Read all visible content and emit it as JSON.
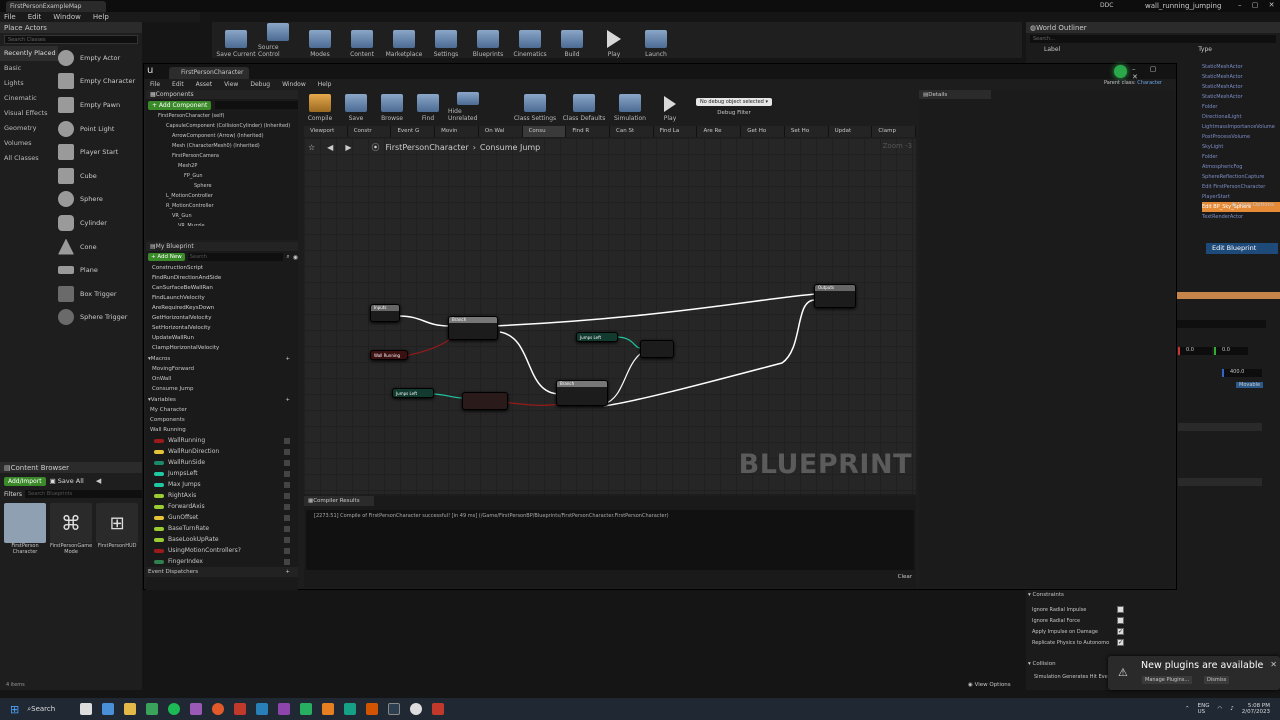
{
  "editor": {
    "title_tab": "FirstPersonExampleMap",
    "project_name": "wall_running_jumping",
    "menu": [
      "File",
      "Edit",
      "Window",
      "Help"
    ],
    "source_label": "DDC"
  },
  "place_actors": {
    "tab": "Place Actors",
    "search_placeholder": "Search Classes",
    "categories": [
      "Recently Placed",
      "Basic",
      "Lights",
      "Cinematic",
      "Visual Effects",
      "Geometry",
      "Volumes",
      "All Classes"
    ],
    "items": [
      "Empty Actor",
      "Empty Character",
      "Empty Pawn",
      "Point Light",
      "Player Start",
      "Cube",
      "Sphere",
      "Cylinder",
      "Cone",
      "Plane",
      "Box Trigger",
      "Sphere Trigger"
    ]
  },
  "main_toolbar": [
    "Save Current",
    "Source Control",
    "Modes",
    "Content",
    "Marketplace",
    "Settings",
    "Blueprints",
    "Cinematics",
    "Build",
    "Play",
    "Launch"
  ],
  "world_outliner": {
    "tab": "World Outliner",
    "search_placeholder": "Search...",
    "col_label": "Label",
    "col_type": "Type",
    "types": [
      "StaticMeshActor",
      "StaticMeshActor",
      "StaticMeshActor",
      "StaticMeshActor",
      "Folder",
      "DirectionalLight",
      "LightmassImportanceVolume",
      "PostProcessVolume",
      "SkyLight",
      "Folder",
      "AtmosphericFog",
      "SphereReflectionCapture",
      "Edit FirstPersonCharacter",
      "PlayerStart",
      "Edit BP_Sky_Sphere",
      "TextRenderActor"
    ],
    "view_options": "View Options",
    "edit_blueprint": "Edit Blueprint"
  },
  "blueprint_editor": {
    "tab": "FirstPersonCharacter",
    "parent_class_label": "Parent class:",
    "parent_class": "Character",
    "menu": [
      "File",
      "Edit",
      "Asset",
      "View",
      "Debug",
      "Window",
      "Help"
    ],
    "toolbar": [
      "Compile",
      "Save",
      "Browse",
      "Find",
      "Hide Unrelated",
      "Class Settings",
      "Class Defaults",
      "Simulation",
      "Play"
    ],
    "debug_filter_value": "No debug object selected",
    "debug_filter_label": "Debug Filter",
    "graph_tabs": [
      "Viewport",
      "Constr",
      "Event G",
      "Movin",
      "On Wal",
      "Consu",
      "Find R",
      "Can St",
      "Find La",
      "Are Re",
      "Get Ho",
      "Set Ho",
      "Updat",
      "Clamp"
    ],
    "breadcrumb_root": "FirstPersonCharacter",
    "breadcrumb_leaf": "Consume Jump",
    "zoom": "Zoom -3",
    "watermark": "BLUEPRINT",
    "components": {
      "tab": "Components",
      "add_button": "+ Add Component",
      "tree": [
        "FirstPersonCharacter (self)",
        "CapsuleComponent (CollisionCylinder) (Inherited)",
        "ArrowComponent (Arrow) (Inherited)",
        "Mesh (CharacterMesh0) (Inherited)",
        "FirstPersonCamera",
        "Mesh2P",
        "FP_Gun",
        "Sphere",
        "L_MotionController",
        "R_MotionController",
        "VR_Gun",
        "VR_Muzzle"
      ]
    },
    "my_blueprint": {
      "tab": "My Blueprint",
      "add_new": "+ Add New",
      "search_placeholder": "Search",
      "functions": [
        "ConstructionScript",
        "FindRunDirectionAndSide",
        "CanSurfaceBeWallRan",
        "FindLaunchVelocity",
        "AreRequiredKeysDown",
        "GetHorizontalVelocity",
        "SetHorizontalVelocity",
        "UpdateWallRun",
        "ClampHorizontalVelocity"
      ],
      "macros_label": "Macros",
      "macros": [
        "MovingForward",
        "OnWall",
        "Consume Jump"
      ],
      "variables_label": "Variables",
      "var_groups": [
        "My Character",
        "Components"
      ],
      "wall_running_label": "Wall Running",
      "variables": [
        {
          "name": "WallRunning",
          "color": "#9b1a1a"
        },
        {
          "name": "WallRunDirection",
          "color": "#e6c43a"
        },
        {
          "name": "WallRunSide",
          "color": "#1a8a6a"
        },
        {
          "name": "JumpsLeft",
          "color": "#1ec8a0"
        },
        {
          "name": "Max Jumps",
          "color": "#1ec8a0"
        },
        {
          "name": "RightAxis",
          "color": "#9acd32"
        },
        {
          "name": "ForwardAxis",
          "color": "#9acd32"
        },
        {
          "name": "GunOffset",
          "color": "#e6c43a"
        },
        {
          "name": "BaseTurnRate",
          "color": "#9acd32"
        },
        {
          "name": "BaseLookUpRate",
          "color": "#9acd32"
        },
        {
          "name": "UsingMotionControllers?",
          "color": "#9b1a1a"
        },
        {
          "name": "FingerIndex",
          "color": "#2f7f4f"
        }
      ],
      "event_dispatchers": "Event Dispatchers"
    },
    "nodes": {
      "inputs": "Inputs",
      "branch1": "Branch",
      "branch2": "Branch",
      "outputs": "Outputs",
      "wall_running": "Wall Running",
      "jumps_left_1": "Jumps Left",
      "jumps_left_2": "Jumps Left"
    },
    "compiler": {
      "tab": "Compiler Results",
      "message": "[2273.51] Compile of FirstPersonCharacter successful! [in 49 ms] (/Game/FirstPersonBP/Blueprints/FirstPersonCharacter.FirstPersonCharacter)",
      "clear": "Clear"
    },
    "details": {
      "tab": "Details"
    }
  },
  "content_browser": {
    "tab": "Content Browser",
    "add_import": "Add/Import",
    "save_all": "Save All",
    "filters": "Filters",
    "search_placeholder": "Search Blueprints",
    "assets": [
      "FirstPerson Character",
      "FirstPersonGame Mode",
      "FirstPersonHUD"
    ],
    "count": "4 items"
  },
  "details_panel": {
    "values": [
      "0.0",
      "0.0",
      "400.0"
    ],
    "mobility": "Movable",
    "constraints": "Constraints",
    "checks": [
      {
        "label": "Ignore Radial Impulse",
        "checked": false
      },
      {
        "label": "Ignore Radial Force",
        "checked": false
      },
      {
        "label": "Apply Impulse on Damage",
        "checked": true
      },
      {
        "label": "Replicate Physics to Autonomo",
        "checked": true
      }
    ],
    "collision": "Collision",
    "collision_row": "Simulation Generates Hit Even",
    "view_options": "View Options"
  },
  "notification": {
    "text": "New plugins are available",
    "manage": "Manage Plugins...",
    "dismiss": "Dismiss"
  },
  "taskbar": {
    "search": "Search",
    "lang1": "ENG",
    "lang2": "US",
    "time": "5:08 PM",
    "date": "2/07/2023"
  }
}
